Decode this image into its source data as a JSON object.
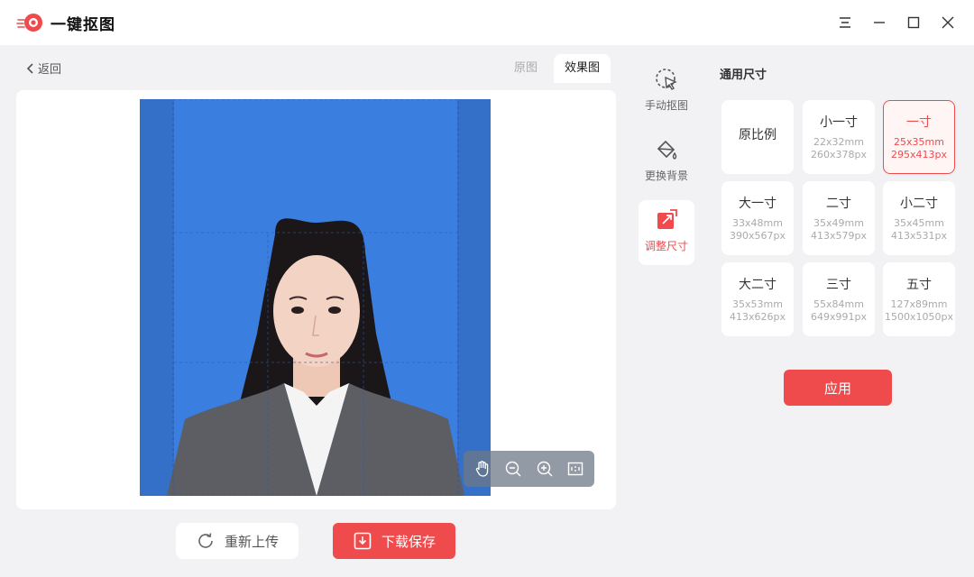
{
  "app": {
    "title": "一键抠图"
  },
  "nav": {
    "back_label": "返回"
  },
  "view_tabs": [
    {
      "label": "原图",
      "active": false
    },
    {
      "label": "效果图",
      "active": true
    }
  ],
  "tools": [
    {
      "label": "手动抠图",
      "icon": "manual-cutout-icon",
      "active": false
    },
    {
      "label": "更换背景",
      "icon": "paint-bucket-icon",
      "active": false
    },
    {
      "label": "调整尺寸",
      "icon": "resize-icon",
      "active": true
    }
  ],
  "size_panel": {
    "title": "通用尺寸",
    "sizes": [
      {
        "name": "原比例",
        "mm": "",
        "px": "",
        "selected": false
      },
      {
        "name": "小一寸",
        "mm": "22x32mm",
        "px": "260x378px",
        "selected": false
      },
      {
        "name": "一寸",
        "mm": "25x35mm",
        "px": "295x413px",
        "selected": true
      },
      {
        "name": "大一寸",
        "mm": "33x48mm",
        "px": "390x567px",
        "selected": false
      },
      {
        "name": "二寸",
        "mm": "35x49mm",
        "px": "413x579px",
        "selected": false
      },
      {
        "name": "小二寸",
        "mm": "35x45mm",
        "px": "413x531px",
        "selected": false
      },
      {
        "name": "大二寸",
        "mm": "35x53mm",
        "px": "413x626px",
        "selected": false
      },
      {
        "name": "三寸",
        "mm": "55x84mm",
        "px": "649x991px",
        "selected": false
      },
      {
        "name": "五寸",
        "mm": "127x89mm",
        "px": "1500x1050px",
        "selected": false
      }
    ],
    "apply_label": "应用"
  },
  "actions": {
    "reupload_label": "重新上传",
    "download_label": "下载保存"
  },
  "colors": {
    "accent": "#ef4b4d",
    "photo_background": "#3a7fe0"
  }
}
